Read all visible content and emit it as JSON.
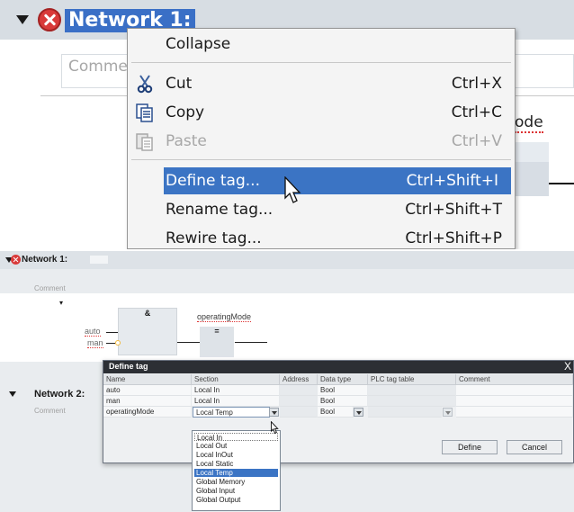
{
  "top": {
    "network_title": "Network 1:",
    "comment_placeholder": "Comme",
    "partial_label": "ode",
    "context_menu": {
      "items": [
        {
          "label": "Collapse",
          "shortcut": ""
        },
        {
          "label": "Cut",
          "shortcut": "Ctrl+X",
          "icon": "scissors-icon"
        },
        {
          "label": "Copy",
          "shortcut": "Ctrl+C",
          "icon": "copy-icon"
        },
        {
          "label": "Paste",
          "shortcut": "Ctrl+V",
          "icon": "paste-icon",
          "disabled": true
        },
        {
          "label": "Define tag...",
          "shortcut": "Ctrl+Shift+I",
          "highlighted": true
        },
        {
          "label": "Rename tag...",
          "shortcut": "Ctrl+Shift+T"
        },
        {
          "label": "Rewire tag...",
          "shortcut": "Ctrl+Shift+P"
        }
      ]
    }
  },
  "bottom": {
    "network1_title": "Network 1:",
    "network1_comment": "Comment",
    "ladder": {
      "and_label": "&",
      "input_auto": "auto",
      "input_man": "man",
      "output_label": "operatingMode",
      "assign_label": "="
    },
    "network2_title": "Network 2:",
    "network2_comment": "Comment",
    "dialog": {
      "title": "Define tag",
      "close": "X",
      "columns": [
        "Name",
        "Section",
        "Address",
        "Data type",
        "PLC tag table",
        "Comment"
      ],
      "rows": [
        {
          "name": "auto",
          "section": "Local In",
          "address": "",
          "data_type": "Bool",
          "plc_tag_table": "",
          "comment": ""
        },
        {
          "name": "man",
          "section": "Local In",
          "address": "",
          "data_type": "Bool",
          "plc_tag_table": "",
          "comment": ""
        },
        {
          "name": "operatingMode",
          "section": "Local Temp",
          "address": "",
          "data_type": "Bool",
          "plc_tag_table": "",
          "comment": ""
        }
      ],
      "define_button": "Define",
      "cancel_button": "Cancel"
    },
    "section_options": [
      "Local In",
      "Local Out",
      "Local InOut",
      "Local Static",
      "Local Temp",
      "Global Memory",
      "Global Input",
      "Global Output"
    ],
    "selected_section": "Local Temp"
  },
  "colors": {
    "highlight": "#3b74c4",
    "error": "#d93a3a",
    "dialog_title": "#2c2f34"
  }
}
